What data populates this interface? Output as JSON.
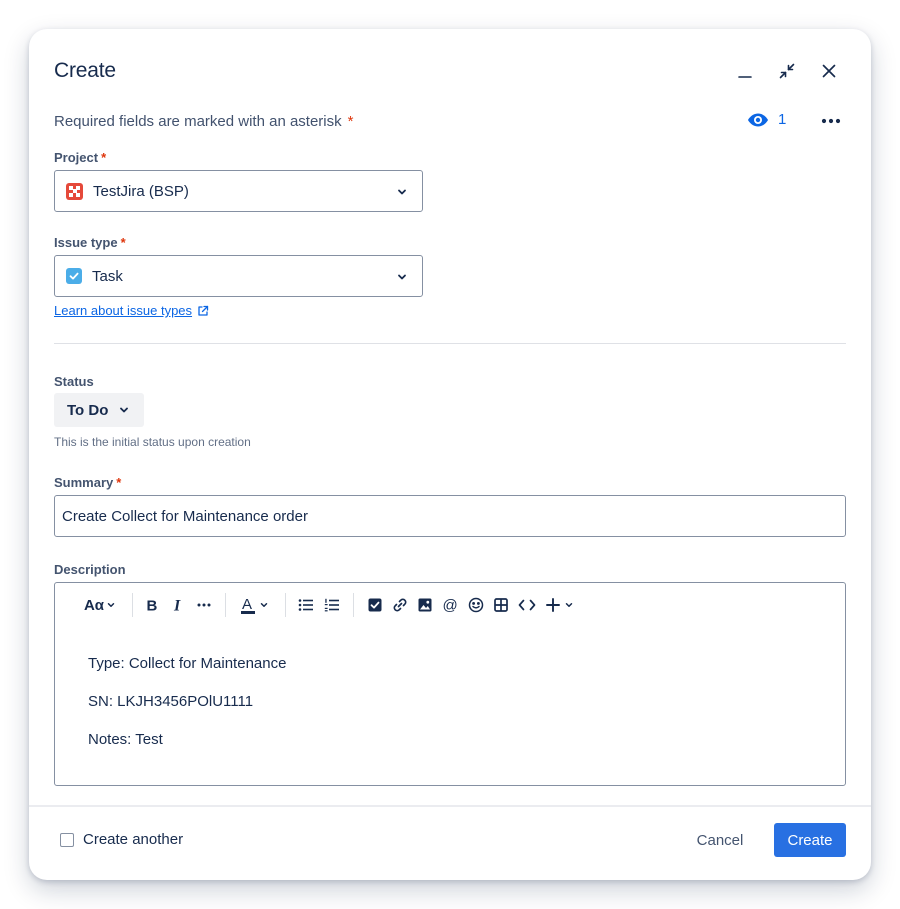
{
  "modal": {
    "title": "Create",
    "required_note": "Required fields are marked with an asterisk",
    "asterisk": "*",
    "watchers_count": "1"
  },
  "fields": {
    "project": {
      "label": "Project",
      "value": "TestJira (BSP)",
      "icon": "project-avatar-icon"
    },
    "issue_type": {
      "label": "Issue type",
      "value": "Task",
      "icon": "task-icon",
      "learn_link": "Learn about issue types"
    },
    "status": {
      "label": "Status",
      "value": "To Do",
      "helper": "This is the initial status upon creation"
    },
    "summary": {
      "label": "Summary",
      "value": "Create Collect for Maintenance order"
    },
    "description": {
      "label": "Description",
      "toolbar": {
        "text_style": "Aα",
        "items": [
          "text-style",
          "bold",
          "italic",
          "more-formatting",
          "text-color",
          "bullet-list",
          "numbered-list",
          "action-item",
          "link",
          "image",
          "mention",
          "emoji",
          "table",
          "code-snippet",
          "insert-more"
        ]
      },
      "lines": [
        "Type: Collect for Maintenance",
        "SN: LKJH3456POlU1111",
        "Notes: Test"
      ]
    }
  },
  "footer": {
    "create_another_label": "Create another",
    "cancel_label": "Cancel",
    "create_label": "Create"
  },
  "colors": {
    "primary": "#2870e2",
    "link": "#0c66e4",
    "required": "#de350b",
    "text": "#172b4d"
  }
}
